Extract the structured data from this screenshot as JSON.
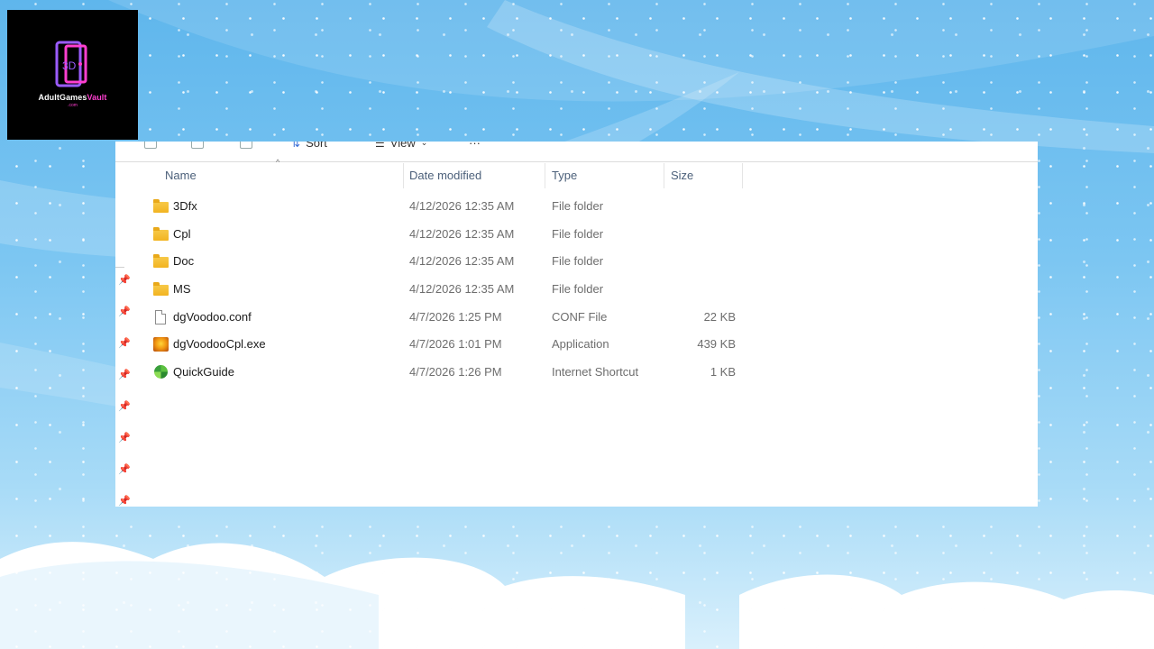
{
  "logo": {
    "brand_main": "AdultGames",
    "brand_accent": "Vault",
    "brand_sub": ".com"
  },
  "toolbar": {
    "sort_label": "Sort",
    "view_label": "View",
    "more_label": "···"
  },
  "columns": {
    "name": "Name",
    "date_modified": "Date modified",
    "type": "Type",
    "size": "Size"
  },
  "files": [
    {
      "name": "3Dfx",
      "date": "4/12/2026 12:35 AM",
      "type": "File folder",
      "size": "",
      "icon": "folder-icon"
    },
    {
      "name": "Cpl",
      "date": "4/12/2026 12:35 AM",
      "type": "File folder",
      "size": "",
      "icon": "folder-icon"
    },
    {
      "name": "Doc",
      "date": "4/12/2026 12:35 AM",
      "type": "File folder",
      "size": "",
      "icon": "folder-icon"
    },
    {
      "name": "MS",
      "date": "4/12/2026 12:35 AM",
      "type": "File folder",
      "size": "",
      "icon": "folder-icon"
    },
    {
      "name": "dgVoodoo.conf",
      "date": "4/7/2026 1:25 PM",
      "type": "CONF File",
      "size": "22 KB",
      "icon": "document-icon"
    },
    {
      "name": "dgVoodooCpl.exe",
      "date": "4/7/2026 1:01 PM",
      "type": "Application",
      "size": "439 KB",
      "icon": "application-icon"
    },
    {
      "name": "QuickGuide",
      "date": "4/7/2026 1:26 PM",
      "type": "Internet Shortcut",
      "size": "1 KB",
      "icon": "internet-shortcut-icon"
    }
  ],
  "colors": {
    "header_text": "#4c607a",
    "meta_text": "#6d6d6d",
    "folder": "#f7c948"
  }
}
